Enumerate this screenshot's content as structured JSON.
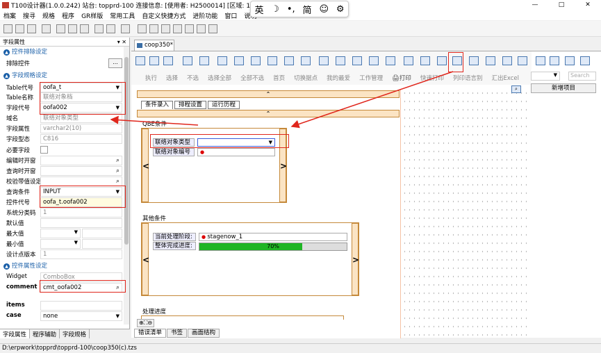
{
  "window": {
    "title": "T100设计器(1.0.0.242) 站台: topprd-100 连接信息: [使用者: H2500014]    [区域: 1]",
    "min": "—",
    "max": "□",
    "close": "✕"
  },
  "ime": {
    "items": [
      "英",
      "☽",
      "•,",
      "简",
      "☺",
      "⚙"
    ]
  },
  "menu": [
    "档案",
    "搜寻",
    "规格",
    "程序",
    "GR样版",
    "常用工具",
    "自定义快捷方式",
    "进阶功能",
    "窗口",
    "说明"
  ],
  "left_panel": {
    "header": "字段属性",
    "header_ctl": "▾ ✕",
    "sections": {
      "s1": "控件排除设定",
      "s2": "字段规格设定",
      "s3": "控件属性设定"
    },
    "rows": {
      "exclude": {
        "label": "排除控件",
        "button": "..."
      },
      "table_code": {
        "label": "Table代号",
        "value": "oofa_t"
      },
      "table_name": {
        "label": "Table名称",
        "value": "联络对象档"
      },
      "field_code": {
        "label": "字段代号",
        "value": "oofa002"
      },
      "domain": {
        "label": "域名",
        "value": "联络对象类型"
      },
      "field_attr": {
        "label": "字段属性",
        "value": "varchar2(10)"
      },
      "field_type": {
        "label": "字段型态",
        "value": "C816"
      },
      "required": {
        "label": "必要字段"
      },
      "edit_open": {
        "label": "编辑时开窗"
      },
      "query_open": {
        "label": "查询时开窗"
      },
      "check_default": {
        "label": "校验带值设定"
      },
      "query_cond": {
        "label": "查询条件",
        "value": "INPUT"
      },
      "control_code": {
        "label": "控件代号",
        "value": "oofa_t.oofa002"
      },
      "sys_class": {
        "label": "系统分类码",
        "value": "1"
      },
      "default_val": {
        "label": "默认值"
      },
      "max_val": {
        "label": "最大值"
      },
      "min_val": {
        "label": "最小值"
      },
      "design_ver": {
        "label": "设计点版本",
        "value": "1"
      },
      "widget": {
        "label": "Widget",
        "value": "ComboBox"
      },
      "comment": {
        "label": "comment",
        "value": "cmt_oofa002"
      },
      "items": {
        "label": "items"
      },
      "case": {
        "label": "case",
        "value": "none"
      }
    },
    "tabs": [
      "字段属性",
      "程序辅助",
      "字段规格"
    ]
  },
  "doc_tab": "coop350*",
  "actions": [
    "执行",
    "选择",
    "不选",
    "选择全部",
    "全部不选",
    "首页",
    "切换据点",
    "我的最爱",
    "工作管理",
    "🖨打印",
    "快速打印",
    "列印语言别",
    "汇出Excel"
  ],
  "canvas": {
    "tabs": [
      "条件录入",
      "排程设置",
      "运行历程"
    ],
    "qbe_title": "QBE条件",
    "qbe_fields": [
      "联络对象类型",
      "联络对象编号"
    ],
    "other_title": "其他条件",
    "other_fields": [
      "当前处理阶段:",
      "整体完成进度:"
    ],
    "stage_value": "stagenow_1",
    "progress": 70,
    "progress_label": "70%",
    "process_title": "处理进度",
    "up_arrow": "⌃",
    "left_arrow": "<",
    "right_arrow": ">"
  },
  "right_panel": {
    "search_placeholder": "Search",
    "new_item": "新增项目"
  },
  "bottom_tabs": [
    "错误清单",
    "书签",
    "画面结构"
  ],
  "status": "D:\\erpwork\\topprd\\topprd-100\\coop350(c).tzs",
  "colors": {
    "highlight": "#e0261c",
    "accent": "#1a5fa8",
    "progress": "#1fb524"
  }
}
